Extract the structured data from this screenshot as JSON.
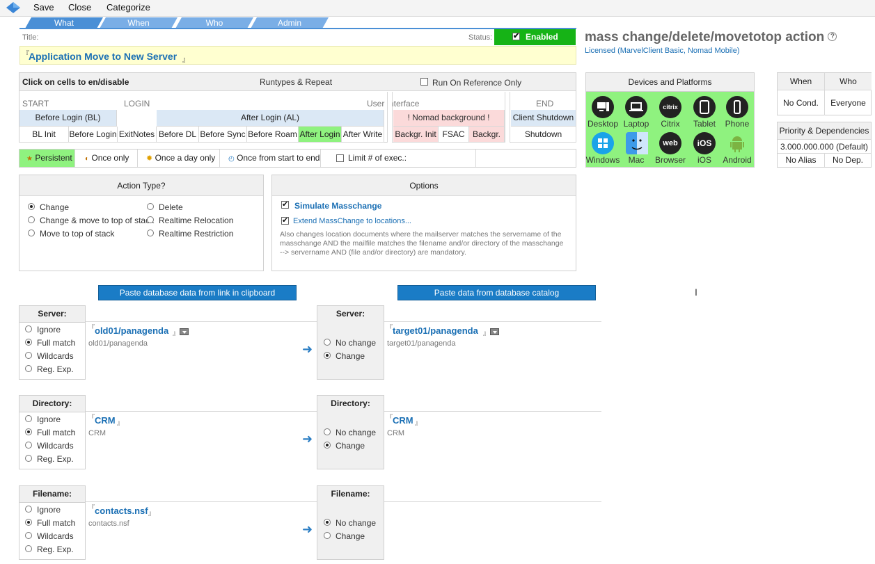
{
  "toolbar": {
    "save": "Save",
    "close": "Close",
    "categorize": "Categorize"
  },
  "tabs": [
    "What",
    "When",
    "Who",
    "Admin"
  ],
  "title_label": "Title:",
  "status_label": "Status:",
  "status_value": "Enabled",
  "title_value": "Application Move to New Server",
  "heading": "mass change/delete/movetotop action",
  "license": "Licensed (MarvelClient Basic, Nomad Mobile)",
  "runtypes": {
    "click_hint": "Click on cells to en/disable",
    "header": "Runtypes & Repeat",
    "run_ref_only": "Run On Reference Only",
    "start": "START",
    "login": "LOGIN",
    "ui": "User Interface",
    "end": "END",
    "before_login_bl": "Before Login (BL)",
    "after_login_al": "After Login (AL)",
    "nomad_bg": "! Nomad background !",
    "client_shutdown": "Client Shutdown",
    "cells": [
      "BL Init",
      "Before Login",
      "ExitNotes",
      "Before DL",
      "Before Sync",
      "Before Roam",
      "After Login",
      "After Write",
      "Backgr. Init",
      "FSAC",
      "Backgr."
    ],
    "shutdown": "Shutdown"
  },
  "repeat": {
    "persistent": "Persistent",
    "once_only": "Once only",
    "once_day": "Once a day only",
    "once_start_end": "Once from start to end",
    "limit": "Limit # of exec.:"
  },
  "devices": {
    "header": "Devices and Platforms",
    "row1": [
      "Desktop",
      "Laptop",
      "Citrix",
      "Tablet",
      "Phone"
    ],
    "row2": [
      "Windows",
      "Mac",
      "Browser",
      "iOS",
      "Android"
    ],
    "citrix_glyph": "citrix",
    "web_glyph": "web",
    "ios_glyph": "iOS"
  },
  "when_who": {
    "when": "When",
    "who": "Who",
    "no_cond": "No Cond.",
    "everyone": "Everyone"
  },
  "priority": {
    "header": "Priority & Dependencies",
    "value": "3.000.000.000 (Default)",
    "no_alias": "No Alias",
    "no_dep": "No Dep."
  },
  "action_type": {
    "header": "Action Type?",
    "left": [
      "Change",
      "Change & move to top of stack",
      "Move to top of stack"
    ],
    "right": [
      "Delete",
      "Realtime Relocation",
      "Realtime Restriction"
    ]
  },
  "options": {
    "header": "Options",
    "simulate": "Simulate Masschange",
    "extend": "Extend MassChange to locations...",
    "desc1": "Also changes location documents where the mailserver matches the servername of the",
    "desc2": "masschange AND the mailfile matches the filename and/or directory of the masschange",
    "desc3": "--> servername AND (file and/or directory) are mandatory."
  },
  "buttons": {
    "paste_link": "Paste database data from link in clipboard",
    "paste_catalog": "Paste data from database catalog"
  },
  "match_opts": [
    "Ignore",
    "Full match",
    "Wildcards",
    "Reg. Exp."
  ],
  "change_opts": [
    "No change",
    "Change"
  ],
  "server": {
    "label": "Server:",
    "src": "old01/panagenda",
    "src_sub": "old01/panagenda",
    "dst": "target01/panagenda",
    "dst_sub": "target01/panagenda"
  },
  "directory": {
    "label": "Directory:",
    "src": "CRM",
    "src_sub": "CRM",
    "dst": "CRM",
    "dst_sub": "CRM"
  },
  "filename": {
    "label": "Filename:",
    "src": "contacts.nsf",
    "src_sub": "contacts.nsf"
  },
  "marks": {
    "open": "『",
    "close": "』"
  }
}
